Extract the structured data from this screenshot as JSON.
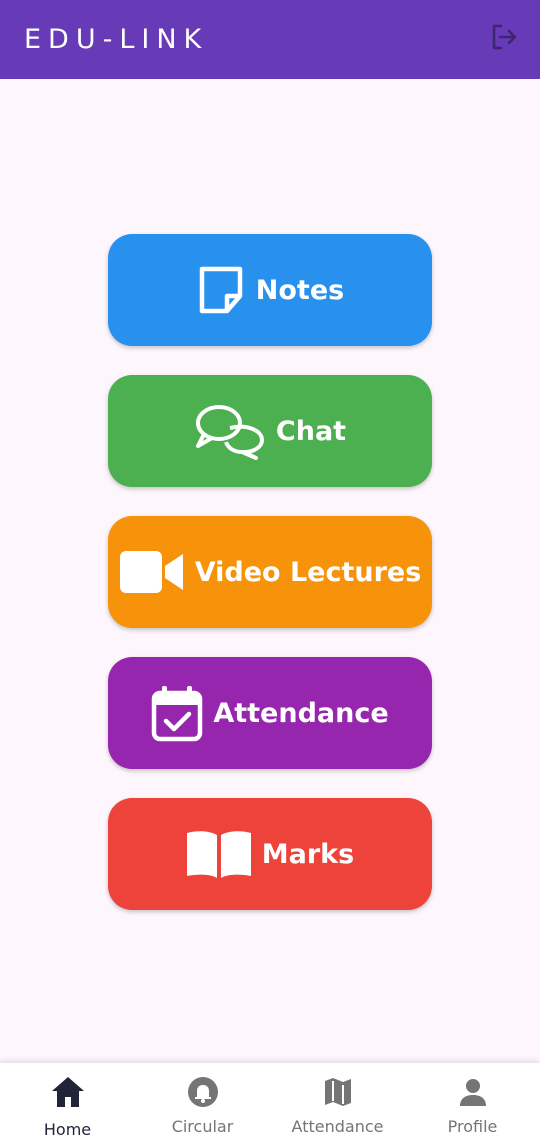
{
  "app_bar": {
    "title": "EDU-LINK",
    "logout_icon": "logout-icon",
    "background": "#673ab7"
  },
  "menu": [
    {
      "label": "Notes",
      "icon": "note-icon",
      "color": "#2891ee"
    },
    {
      "label": "Chat",
      "icon": "chat-icon",
      "color": "#4caf50"
    },
    {
      "label": "Video Lectures",
      "icon": "video-camera-icon",
      "color": "#f7930b"
    },
    {
      "label": "Attendance",
      "icon": "calendar-check-icon",
      "color": "#9626ae"
    },
    {
      "label": "Marks",
      "icon": "book-open-icon",
      "color": "#ee433b"
    }
  ],
  "bottom_nav": {
    "items": [
      {
        "label": "Home",
        "icon": "home-icon",
        "active": true
      },
      {
        "label": "Circular",
        "icon": "bell-icon",
        "active": false
      },
      {
        "label": "Attendance",
        "icon": "map-icon",
        "active": false
      },
      {
        "label": "Profile",
        "icon": "person-icon",
        "active": false
      }
    ]
  }
}
